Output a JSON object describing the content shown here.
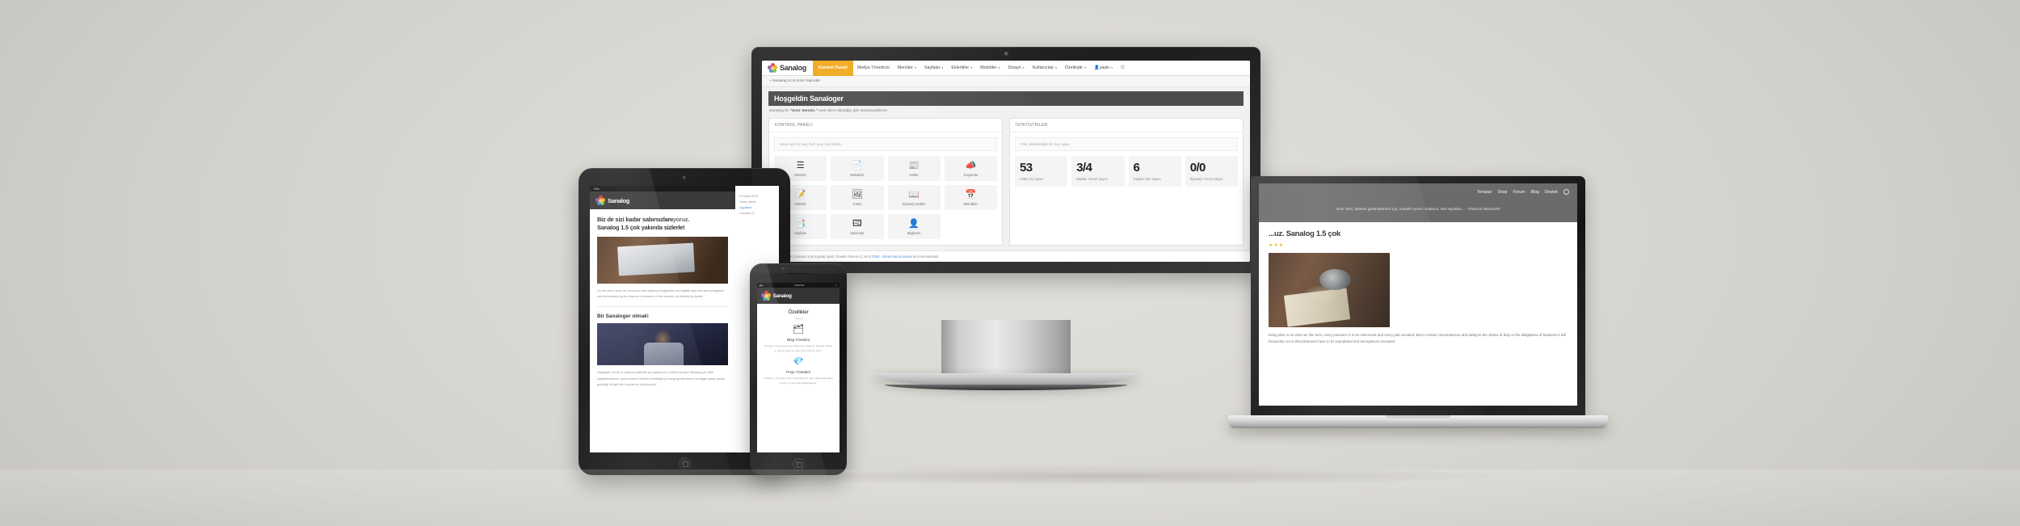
{
  "scene": {
    "title": "Sanalog CMS responsive device showcase",
    "background_color": "#dbd9d3",
    "accent_color": "#f0a91e"
  },
  "brand": {
    "name": "Sanalog",
    "logo_icon": "colorful-flower-logo"
  },
  "monitor": {
    "device": "desktop-monitor",
    "nav": {
      "active_item": "Kontrol Paneli",
      "items": [
        {
          "label": "Kontrol Paneli",
          "active": true,
          "caret": false
        },
        {
          "label": "Medya Yöneticisi",
          "active": false,
          "caret": false
        },
        {
          "label": "Menüler",
          "active": false,
          "caret": true
        },
        {
          "label": "Sayfalar",
          "active": false,
          "caret": true
        },
        {
          "label": "Eklentiler",
          "active": false,
          "caret": true
        },
        {
          "label": "Modüller",
          "active": false,
          "caret": true
        },
        {
          "label": "Dizayn",
          "active": false,
          "caret": true
        },
        {
          "label": "Kullanıcılar",
          "active": false,
          "caret": true
        },
        {
          "label": "Özelleştir",
          "active": false,
          "caret": true
        }
      ],
      "user_label": "yasin",
      "user_icon": "user-icon",
      "logout_icon": "logout-icon"
    },
    "breadcrumb": "Sanalog v1.5 Artık Yayında!",
    "heading": "Hoşgeldin Sanaloger",
    "subtitle_prefix": "Sanalog ile ",
    "subtitle_quote": "\"Sınır Sensin.\"",
    "subtitle_suffix": " web siteni dilediğin gibi tasarlayabilirsin.",
    "control_panel": {
      "title": "KONTROL PANELİ",
      "note": "Senin için bir kaç hızlı araç hazırladık",
      "tiles": [
        {
          "label": "Menüler",
          "icon": "list-icon",
          "glyph": "☰"
        },
        {
          "label": "Makaleler",
          "icon": "document-icon",
          "glyph": "📄"
        },
        {
          "label": "Haber",
          "icon": "newspaper-icon",
          "glyph": "📰"
        },
        {
          "label": "Duyurular",
          "icon": "megaphone-icon",
          "glyph": "📣"
        },
        {
          "label": "Anketler",
          "icon": "checklist-icon",
          "glyph": "📝"
        },
        {
          "label": "Galeri",
          "icon": "image-icon",
          "glyph": "🖼"
        },
        {
          "label": "Ziyaretçi Defteri",
          "icon": "book-icon",
          "glyph": "📖"
        },
        {
          "label": "Etkinlikler",
          "icon": "calendar-icon",
          "glyph": "📅"
        },
        {
          "label": "Sayfalar",
          "icon": "pages-icon",
          "glyph": "📑"
        },
        {
          "label": "Şablonlar",
          "icon": "template-icon",
          "glyph": "🖽"
        },
        {
          "label": "Bilgilerim",
          "icon": "person-icon",
          "glyph": "👤"
        }
      ]
    },
    "statistics": {
      "title": "İSTATİSTİKLER",
      "note": "Fikir alabileceğin bir kaç rapor",
      "stats": [
        {
          "value": "53",
          "label": "Anket Oy Sayısı"
        },
        {
          "value": "3/4",
          "label": "Makale Yorum Sayısı"
        },
        {
          "value": "6",
          "label": "Toplam Üye Sayısı"
        },
        {
          "value": "0/0",
          "label": "Ziyaretçi Yorum Sayısı"
        }
      ]
    },
    "footer": {
      "prefix": "SANALOG v1.5",
      "middle": " | Ücretsiz Açık Kaynak İçerik Yönetim Sistemi (C.M.S) ",
      "link": "GNU - Genel Kamu Lisansı",
      "suffix": " ile korunmaktadır."
    }
  },
  "laptop": {
    "device": "laptop",
    "nav_items": [
      "Temalar",
      "Shop",
      "Forum",
      "Blog",
      "Destek"
    ],
    "nav_icon": "globe-icon",
    "quote": "\"Sınır ders, tüketen görüntülerden için, mesafe Aynen rotalarca, ötel sayfaları... - Friedrich Nietzsche\"",
    "heading": "...uz. Sanalog 1.5 çok",
    "rating_icon": "star-icon",
    "rating": "★★★",
    "body_text": "being able to do what we like best, every pleasure is to be welcomed and every pain avoided. But in certain circumstances and owing to the claims of duty or the obligations of business it will frequently occur that pleasures have to be repudiated and annoyances accepted."
  },
  "tablet": {
    "device": "tablet",
    "status_label": "iPad",
    "heading_line1": "Biz de sizi kadar sabırsızlanı",
    "heading_line1_tail": "yoruz.",
    "heading_line2": "Sanalog 1.5 çok yakında sizlerle!",
    "body_text": "On the other hand, we denounce with righteous indignation and dislike men who are so beguiled and demoralized by the charms of pleasure of the moment, so blinded by desire.",
    "heading2": "Bir Sanaloger olmak!",
    "body_text2": "Sanaloger olmak ve aramıza katılmak için şartlarımız, bizlerle beraber Sanalog için neler yapabileceksiniz, ayrıca sizlerin bizlerle birlikteliği için hangi gerekli beceri ve bilgiye sahip olması gerektiği ile ilgili tüm sorularınızı yanıtlıyoruz!",
    "sidebar": {
      "date": "03 Kasım 2015",
      "author_label": "Yazan: admin",
      "link": "Uygulama",
      "meta": "Yorumlar (0)"
    }
  },
  "phone": {
    "device": "phone",
    "carrier": "CARRIER",
    "battery_icon": "battery-icon",
    "signal_icon": "signal-icon",
    "heading": "Özellikler",
    "features": [
      {
        "icon": "blog-icon",
        "glyph": "🗂",
        "title": "Blog Yönetimi",
        "text": "Quisque consequat dolor nulla lacus vivamus. Feugiat massa a, laboris eget leo odio rutrum donec dolor."
      },
      {
        "icon": "diamond-icon",
        "glyph": "💎",
        "title": "Proje Yönetimi",
        "text": "Habitasse phasellus odio suspendisse a odio. Maecenas tellus cursus, sit sed vitae pellentesque."
      }
    ]
  }
}
